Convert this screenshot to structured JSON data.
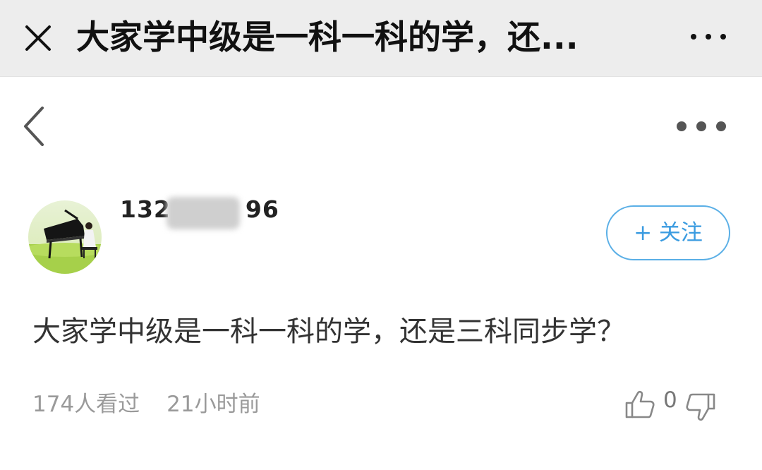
{
  "window": {
    "title": "大家学中级是一科一科的学，还..."
  },
  "post": {
    "username_start": "132",
    "username_end": "96",
    "follow_label": "+ 关注",
    "question": "大家学中级是一科一科的学，还是三科同步学？",
    "views": "174人看过",
    "time": "21小时前",
    "likes": "0"
  },
  "icons": {
    "close": "close-icon",
    "window_more": "more-horizontal-icon",
    "back": "chevron-left-icon",
    "page_more": "more-horizontal-icon",
    "like": "thumbs-up-icon",
    "dislike": "thumbs-down-icon"
  },
  "colors": {
    "accent": "#3a9be0",
    "titlebar_bg": "#ededed"
  }
}
